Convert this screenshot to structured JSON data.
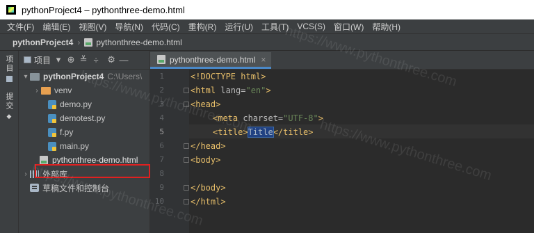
{
  "window": {
    "title": "pythonProject4 – pythonthree-demo.html"
  },
  "menu": [
    "文件(F)",
    "编辑(E)",
    "视图(V)",
    "导航(N)",
    "代码(C)",
    "重构(R)",
    "运行(U)",
    "工具(T)",
    "VCS(S)",
    "窗口(W)",
    "帮助(H)"
  ],
  "navbar": {
    "project": "pythonProject4",
    "file": "pythonthree-demo.html"
  },
  "left_strip": {
    "project_tab": "项目",
    "commit_tab": "提交"
  },
  "project_panel": {
    "label": "项目",
    "tree": [
      {
        "label": "pythonProject4",
        "hint": "C:\\Users\\",
        "kind": "root-folder"
      },
      {
        "label": "venv",
        "kind": "folder"
      },
      {
        "label": "demo.py",
        "kind": "python"
      },
      {
        "label": "demotest.py",
        "kind": "python"
      },
      {
        "label": "f.py",
        "kind": "python"
      },
      {
        "label": "main.py",
        "kind": "python"
      },
      {
        "label": "pythonthree-demo.html",
        "kind": "html"
      },
      {
        "label": "外部库",
        "kind": "libraries"
      },
      {
        "label": "草稿文件和控制台",
        "kind": "scratches"
      }
    ]
  },
  "editor": {
    "tab": "pythonthree-demo.html",
    "line_numbers": [
      "1",
      "2",
      "3",
      "4",
      "5",
      "6",
      "7",
      "8",
      "9",
      "10"
    ],
    "code": {
      "l1_doctype": "<!DOCTYPE html>",
      "l2_open": "<html ",
      "l2_attr": "lang=",
      "l2_val": "\"en\"",
      "l2_close": ">",
      "l3": "<head>",
      "l4_open": "<meta ",
      "l4_attr": "charset=",
      "l4_val": "\"UTF-8\"",
      "l4_close": ">",
      "l5_open": "<title>",
      "l5_text": "Title",
      "l5_close": "</title>",
      "l6": "</head>",
      "l7": "<body>",
      "l9": "</body>",
      "l10": "</html>"
    }
  },
  "watermark": "https://www.pythonthree.com"
}
